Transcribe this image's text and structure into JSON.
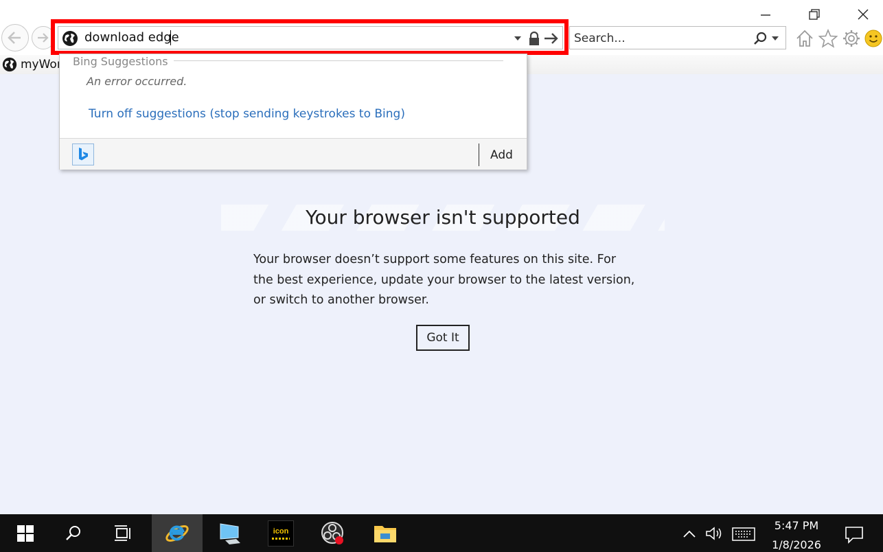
{
  "browser": {
    "address_value": "download edge",
    "search_placeholder": "Search...",
    "favorites_item": "myWor"
  },
  "suggestions": {
    "header": "Bing Suggestions",
    "error": "An error occurred.",
    "turn_off_link": "Turn off suggestions (stop sending keystrokes to Bing)",
    "add_label": "Add"
  },
  "page": {
    "title": "Your browser isn't supported",
    "body": "Your browser doesn’t support some features on this site. For the best experience, update your browser to the latest version, or switch to another browser.",
    "button_label": "Got It"
  },
  "taskbar": {
    "icon_app_label": "icon",
    "time": "5:47 PM",
    "date": "1/8/2026"
  },
  "colors": {
    "highlight": "#ff0000",
    "link": "#2a6ebb",
    "page_background": "#eef1fb",
    "taskbar": "#101010"
  }
}
